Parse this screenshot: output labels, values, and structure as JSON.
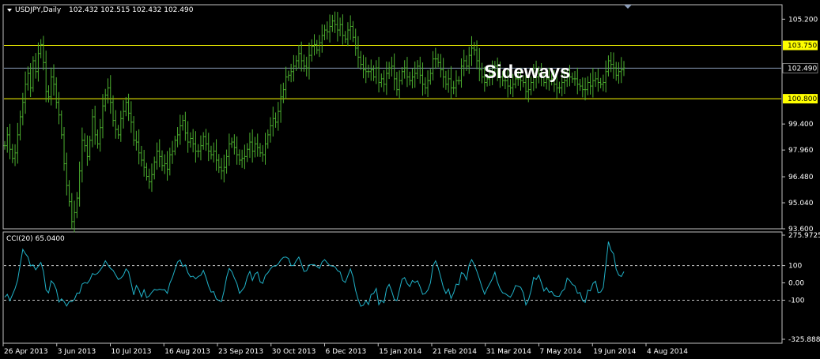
{
  "colors": {
    "background": "#000000",
    "frame": "#c0c0c0",
    "bars": "#4caf2f",
    "cci_line": "#20b2c8",
    "level_lines": "#ffff00",
    "level_label_bg": "#ffff00",
    "current_price_line": "#8a9bb8",
    "annotation": "#ffffff"
  },
  "chart_data": [
    {
      "type": "ohlc",
      "title": "USDJPY,Daily",
      "ohlc_readout": "102.432 102.515 102.432 102.490",
      "annotation": "Sideways",
      "ylim": [
        93.6,
        106.0
      ],
      "y_ticks": [
        "105.200",
        "99.400",
        "97.960",
        "96.480",
        "95.040",
        "93.600"
      ],
      "current_price": {
        "value": 102.49,
        "label": "102.490"
      },
      "levels": [
        {
          "value": 103.75,
          "label": "103.750"
        },
        {
          "value": 100.8,
          "label": "100.800"
        }
      ],
      "x_labels": [
        "26 Apr 2013",
        "3 Jun 2013",
        "10 Jul 2013",
        "16 Aug 2013",
        "23 Sep 2013",
        "30 Oct 2013",
        "6 Dec 2013",
        "15 Jan 2014",
        "21 Feb 2014",
        "31 Mar 2014",
        "7 May 2014",
        "19 Jun 2014",
        "4 Aug 2014"
      ],
      "closes": [
        98.2,
        98.8,
        98.0,
        97.5,
        97.8,
        98.8,
        99.8,
        100.6,
        101.6,
        102.2,
        101.4,
        102.9,
        102.3,
        103.3,
        103.8,
        102.8,
        101.2,
        100.9,
        102.0,
        101.6,
        100.6,
        99.9,
        98.8,
        97.2,
        96.0,
        95.1,
        94.0,
        94.5,
        95.3,
        96.8,
        98.5,
        98.2,
        97.6,
        98.5,
        99.8,
        98.8,
        98.3,
        99.2,
        100.4,
        101.0,
        101.4,
        100.6,
        99.6,
        99.1,
        98.8,
        99.7,
        100.1,
        100.6,
        100.0,
        99.5,
        98.5,
        98.4,
        97.8,
        97.4,
        97.0,
        96.5,
        96.2,
        96.6,
        97.3,
        97.9,
        97.6,
        97.1,
        97.2,
        96.9,
        97.7,
        97.9,
        98.5,
        98.8,
        99.3,
        99.6,
        98.9,
        98.4,
        98.6,
        98.3,
        97.9,
        97.9,
        98.2,
        98.7,
        98.3,
        97.9,
        97.7,
        97.9,
        97.4,
        97.0,
        96.8,
        97.0,
        97.6,
        98.3,
        98.4,
        98.1,
        97.7,
        97.4,
        97.5,
        97.6,
        98.0,
        98.4,
        97.9,
        98.3,
        98.1,
        97.8,
        97.7,
        98.3,
        98.8,
        99.3,
        99.7,
        99.5,
        100.1,
        100.9,
        101.3,
        102.0,
        102.1,
        102.3,
        102.6,
        102.9,
        103.3,
        102.9,
        102.6,
        102.5,
        103.2,
        103.7,
        103.8,
        103.5,
        103.9,
        104.3,
        104.6,
        104.5,
        104.8,
        105.1,
        104.9,
        104.6,
        104.9,
        104.3,
        104.1,
        104.6,
        104.8,
        104.2,
        103.6,
        103.1,
        102.7,
        102.4,
        102.3,
        102.3,
        102.4,
        102.0,
        102.5,
        101.7,
        101.9,
        101.6,
        102.2,
        102.5,
        102.6,
        101.9,
        101.3,
        101.8,
        102.3,
        102.5,
        102.0,
        101.8,
        102.0,
        102.2,
        102.6,
        102.1,
        101.6,
        101.4,
        101.8,
        102.2,
        103.0,
        103.0,
        102.8,
        102.4,
        102.0,
        101.6,
        101.9,
        101.4,
        101.4,
        101.8,
        101.8,
        102.6,
        102.9,
        102.6,
        103.2,
        103.6,
        103.5,
        102.9,
        102.4,
        102.0,
        101.7,
        101.9,
        102.1,
        102.3,
        102.6,
        102.2,
        102.0,
        101.8,
        101.8,
        101.5,
        101.4,
        101.6,
        101.9,
        101.9,
        101.8,
        101.7,
        101.2,
        101.3,
        101.7,
        102.2,
        102.0,
        102.2,
        102.0,
        101.7,
        101.9,
        101.8,
        101.9,
        101.6,
        101.4,
        101.4,
        101.7,
        101.8,
        102.1,
        102.0,
        101.9,
        101.9,
        101.6,
        101.5,
        101.3,
        101.3,
        101.7,
        101.5,
        101.8,
        101.9,
        101.7,
        101.6,
        101.7,
        102.3,
        102.9,
        102.7,
        102.5,
        102.1,
        102.3,
        102.4,
        102.5
      ]
    },
    {
      "type": "line",
      "title": "CCI(20) 65.0400",
      "ylim": [
        -325.888,
        275.9725
      ],
      "y_ticks": [
        {
          "value": 275.9725,
          "label": "275.9725"
        },
        {
          "value": 100,
          "label": "100"
        },
        {
          "value": 0,
          "label": "0.00"
        },
        {
          "value": -100,
          "label": "-100"
        },
        {
          "value": -325.888,
          "label": "-325.888"
        }
      ],
      "dashed_levels": [
        100,
        -100
      ],
      "values": [
        -82.8,
        -66.4,
        -102.7,
        -68.3,
        -32.8,
        16.3,
        106.8,
        193.9,
        169.0,
        149.3,
        97.7,
        104.1,
        75.8,
        96.4,
        118.1,
        66.3,
        -40.3,
        -57.8,
        11.8,
        -4.8,
        -38.6,
        -110.7,
        -92.2,
        -107.8,
        -134.0,
        -107.9,
        -108.3,
        -95.7,
        -58.6,
        -59.8,
        -7.1,
        1.8,
        -2.6,
        17.8,
        54.0,
        47.4,
        55.3,
        73.7,
        95.9,
        127.7,
        103.9,
        83.5,
        72.3,
        45.5,
        19.8,
        27.7,
        44.1,
        80.8,
        63.5,
        -1.7,
        -69.4,
        -14.6,
        -39.6,
        -81.1,
        -39.6,
        -84.8,
        -75.9,
        -54.7,
        -38.0,
        -41.7,
        -36.5,
        -39.6,
        -39.4,
        -60.7,
        -1.7,
        31.7,
        78.2,
        121.1,
        132.3,
        94.7,
        103.9,
        58.5,
        34.6,
        38.7,
        23.7,
        37.1,
        43.9,
        72.0,
        31.7,
        -18.3,
        -53.3,
        -50.4,
        -92.8,
        -101.5,
        -108.0,
        -47.9,
        32.1,
        83.5,
        65.4,
        28.3,
        -4.1,
        -60.3,
        -42.4,
        -22.3,
        34.3,
        66.1,
        14.1,
        51.2,
        62.5,
        5.6,
        -2.7,
        43.2,
        58.2,
        81.5,
        97.2,
        96.9,
        108.7,
        132.4,
        147.1,
        149.3,
        140.5,
        99.4,
        100.3,
        128.6,
        149.2,
        109.2,
        66.0,
        69.9,
        103.2,
        105.5,
        105.8,
        94.3,
        84.1,
        121.0,
        134.4,
        116.1,
        100.1,
        96.7,
        93.5,
        70.8,
        62.8,
        13.9,
        2.4,
        41.3,
        80.6,
        34.7,
        -43.3,
        -95.4,
        -135.1,
        -129.3,
        -102.5,
        -125.8,
        -67.1,
        -61.4,
        -32.5,
        -126.1,
        -101.4,
        -114.7,
        -34.0,
        -8.7,
        -47.5,
        -96.1,
        -102.4,
        -40.2,
        21.1,
        30.5,
        -3.8,
        -21.4,
        13.6,
        2.5,
        12.3,
        -22.8,
        -66.2,
        -61.3,
        -41.5,
        -0.5,
        98.6,
        127.4,
        88.4,
        33.3,
        -25.7,
        -60.8,
        -35.6,
        -89.7,
        -58.0,
        -7.1,
        -10.8,
        59.8,
        51.2,
        17.6,
        104.3,
        134.8,
        105.3,
        67.4,
        22.9,
        -25.3,
        -65.0,
        -32.1,
        -5.0,
        23.2,
        62.0,
        4.9,
        -34.3,
        -57.6,
        -61.8,
        -73.6,
        -82.6,
        -56.7,
        -15.0,
        -19.6,
        -25.7,
        -57.5,
        -127.0,
        -99.2,
        -45.5,
        31.7,
        19.6,
        44.4,
        1.0,
        -47.3,
        -27.6,
        -54.6,
        -49.4,
        -73.6,
        -77.2,
        -77.3,
        -49.0,
        -34.9,
        27.5,
        13.7,
        -8.7,
        -17.5,
        -60.0,
        -55.7,
        -102.3,
        -112.9,
        -41.9,
        -46.0,
        -3.1,
        9.4,
        -56.5,
        -52.8,
        -27.3,
        104.7,
        238.1,
        188.6,
        168.1,
        79.2,
        45.3,
        36.7,
        65.0
      ]
    }
  ]
}
